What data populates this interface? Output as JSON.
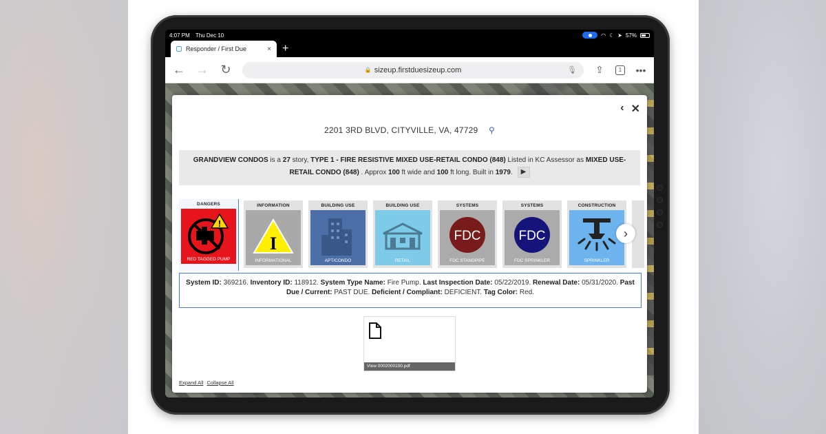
{
  "status_bar": {
    "time": "4:07 PM",
    "date": "Thu Dec 10",
    "battery": "57%"
  },
  "tab": {
    "title": "Responder / First Due",
    "close": "×",
    "new_tab": "+"
  },
  "url_bar": {
    "url": "sizeup.firstduesizeup.com",
    "tab_count": "1"
  },
  "modal": {
    "address": "2201 3RD BLVD, CITYVILLE, VA, 47729",
    "summary": {
      "name": "GRANDVIEW CONDOS",
      "t1": " is a ",
      "stories": "27",
      "t2": " story, ",
      "type": "TYPE 1 - FIRE RESISTIVE MIXED USE-RETAIL CONDO (848)",
      "t3": " Listed in KC Assessor as ",
      "assessor": "MIXED USE-RETAIL CONDO (848)",
      "t4": " . Approx ",
      "width": "100",
      "t5": " ft wide and ",
      "length": "100",
      "t6": " ft long. Built in ",
      "year": "1979",
      "t7": "."
    },
    "cards": [
      {
        "category": "DANGERS",
        "caption": "RED TAGGED PUMP",
        "bg": "#e8141b"
      },
      {
        "category": "INFORMATION",
        "caption": "INFORMATIONAL",
        "bg": "#a9a9a9"
      },
      {
        "category": "BUILDING USE",
        "caption": "APT/CONDO",
        "bg": "#4d6fa8"
      },
      {
        "category": "BUILDING USE",
        "caption": "RETAIL",
        "bg": "#7dcbe9"
      },
      {
        "category": "SYSTEMS",
        "caption": "FDC STANDPIPE",
        "bg": "#ababab",
        "badge": "FDC",
        "badge_color": "#7a1b1b"
      },
      {
        "category": "SYSTEMS",
        "caption": "FDC SPRINKLER",
        "bg": "#ababab",
        "badge": "FDC",
        "badge_color": "#14147a"
      },
      {
        "category": "CONSTRUCTION",
        "caption": "SPRINKLER",
        "bg": "#6db3ee"
      }
    ],
    "detail": {
      "l1": "System ID:",
      "v1": " 369216. ",
      "l2": "Inventory ID:",
      "v2": " 118912. ",
      "l3": "System Type Name:",
      "v3": " Fire Pump. ",
      "l4": "Last Inspection Date:",
      "v4": " 05/22/2019. ",
      "l5": "Renewal Date:",
      "v5": " 05/31/2020. ",
      "l6": "Past Due / Current:",
      "v6": " PAST DUE. ",
      "l7": "Deficient / Compliant:",
      "v7": " DEFICIENT. ",
      "l8": "Tag Color:",
      "v8": " Red."
    },
    "file_caption": "View 0002000100.pdf",
    "expand_all": "Expand All",
    "collapse_all": "Collapse All"
  }
}
